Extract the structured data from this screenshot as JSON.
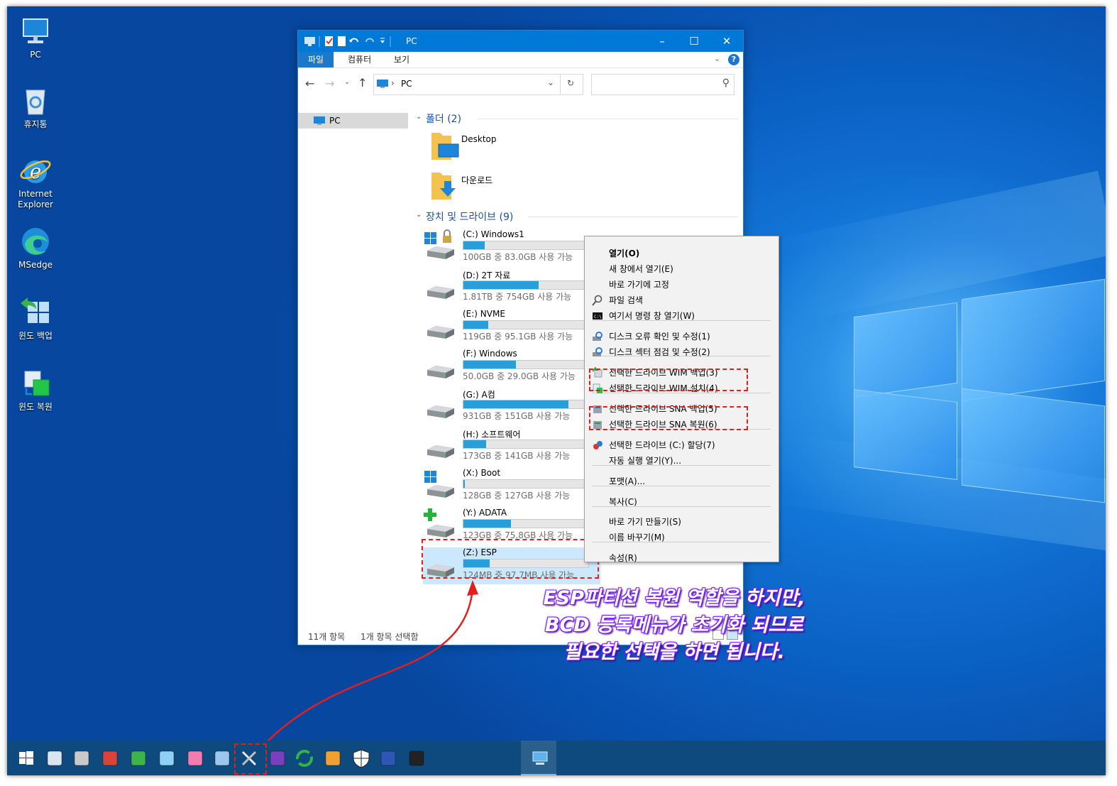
{
  "desktop_icons": [
    {
      "label": "PC",
      "icon": "pc-icon"
    },
    {
      "label": "휴지통",
      "icon": "recycle-bin-icon"
    },
    {
      "label": "Internet Explorer",
      "icon": "internet-explorer-icon"
    },
    {
      "label": "MSedge",
      "icon": "edge-icon"
    },
    {
      "label": "윈도 백업",
      "icon": "windows-backup-icon"
    },
    {
      "label": "윈도 복원",
      "icon": "windows-restore-icon"
    }
  ],
  "window": {
    "title": "PC",
    "ribbon_tabs": [
      "파일",
      "컴퓨터",
      "보기"
    ],
    "address": "PC",
    "search_placeholder": "",
    "nav_selected": "PC",
    "groups": {
      "folders_header": "폴더 (2)",
      "drives_header": "장치 및 드라이브 (9)"
    },
    "folders": [
      {
        "name": "Desktop",
        "icon": "desktop-folder-icon"
      },
      {
        "name": "다운로드",
        "icon": "downloads-folder-icon"
      }
    ],
    "drives": [
      {
        "name": "(C:) Windows1",
        "free_text": "100GB 중 83.0GB 사용 가능",
        "used_fraction": 0.17,
        "icon": "windows-locked-drive-icon"
      },
      {
        "name": "(D:) 2T 자료",
        "free_text": "1.81TB 중 754GB 사용 가능",
        "used_fraction": 0.6,
        "icon": "hard-drive-icon"
      },
      {
        "name": "(E:) NVME",
        "free_text": "119GB 중 95.1GB 사용 가능",
        "used_fraction": 0.2,
        "icon": "hard-drive-icon"
      },
      {
        "name": "(F:) Windows",
        "free_text": "50.0GB 중 29.0GB 사용 가능",
        "used_fraction": 0.42,
        "icon": "hard-drive-icon"
      },
      {
        "name": "(G:) A컴",
        "free_text": "931GB 중 151GB 사용 가능",
        "used_fraction": 0.84,
        "icon": "hard-drive-icon"
      },
      {
        "name": "(H:) 소프트웨어",
        "free_text": "173GB 중 141GB 사용 가능",
        "used_fraction": 0.18,
        "icon": "hard-drive-icon"
      },
      {
        "name": "(X:) Boot",
        "free_text": "128GB 중 127GB 사용 가능",
        "used_fraction": 0.01,
        "icon": "windows-drive-icon"
      },
      {
        "name": "(Y:) ADATA",
        "free_text": "123GB 중 75.8GB 사용 가능",
        "used_fraction": 0.38,
        "icon": "usb-drive-icon"
      },
      {
        "name": "(Z:) ESP",
        "free_text": "124MB 중 97.7MB 사용 가능",
        "used_fraction": 0.21,
        "icon": "hard-drive-icon"
      }
    ],
    "status": {
      "items": "11개 항목",
      "selected": "1개 항목 선택함"
    }
  },
  "context_menu": [
    {
      "label": "열기(O)",
      "bold": true
    },
    {
      "label": "새 창에서 열기(E)"
    },
    {
      "label": "바로 가기에 고정"
    },
    {
      "label": "파일 검색",
      "icon": "search-icon"
    },
    {
      "label": "여기서 명령 창 열기(W)",
      "icon": "cmd-icon"
    },
    {
      "label": "디스크 오류 확인 및 수정(1)",
      "icon": "disk-check-icon"
    },
    {
      "label": "디스크 섹터 점검 및 수정(2)",
      "icon": "disk-check-icon"
    },
    {
      "label": "선택한 드라이브 WIM 백업(3)",
      "icon": "wim-backup-icon"
    },
    {
      "label": "선택한 드라이브 WIM 설치(4)",
      "icon": "wim-install-icon"
    },
    {
      "label": "선택한 드라이브 SNA 백업(5)",
      "icon": "sna-backup-icon"
    },
    {
      "label": "선택한 드라이브 SNA 복원(6)",
      "icon": "sna-restore-icon"
    },
    {
      "label": "선택한 드라이브 (C:) 할당(7)",
      "icon": "assign-icon"
    },
    {
      "label": "자동 실행 열기(Y)..."
    },
    {
      "label": "포맷(A)..."
    },
    {
      "label": "복사(C)"
    },
    {
      "label": "바로 가기 만들기(S)"
    },
    {
      "label": "이름 바꾸기(M)"
    },
    {
      "label": "속성(R)"
    }
  ],
  "annotation": {
    "line1": "ESP파티션 복원 역할을 하지만,",
    "line2": "BCD 등록메뉴가 초기화 되므로",
    "line3": "필요한 선택을 하면 됩니다."
  },
  "taskbar": {
    "icons": [
      "start-icon",
      "monitor-icon",
      "disk-tool-icon",
      "partition-icon",
      "ghost-icon",
      "notepad-icon",
      "app-icon",
      "remote-icon",
      "tools-icon",
      "media-icon",
      "refresh-icon",
      "network-icon",
      "shield-icon",
      "phone-icon",
      "terminal-icon",
      "pc-taskbar-icon"
    ]
  },
  "colors": {
    "accent": "#0078d7",
    "highlight": "#cce8ff",
    "annotation_red": "#e0201f",
    "annotation_purple": "#7a1cff"
  }
}
